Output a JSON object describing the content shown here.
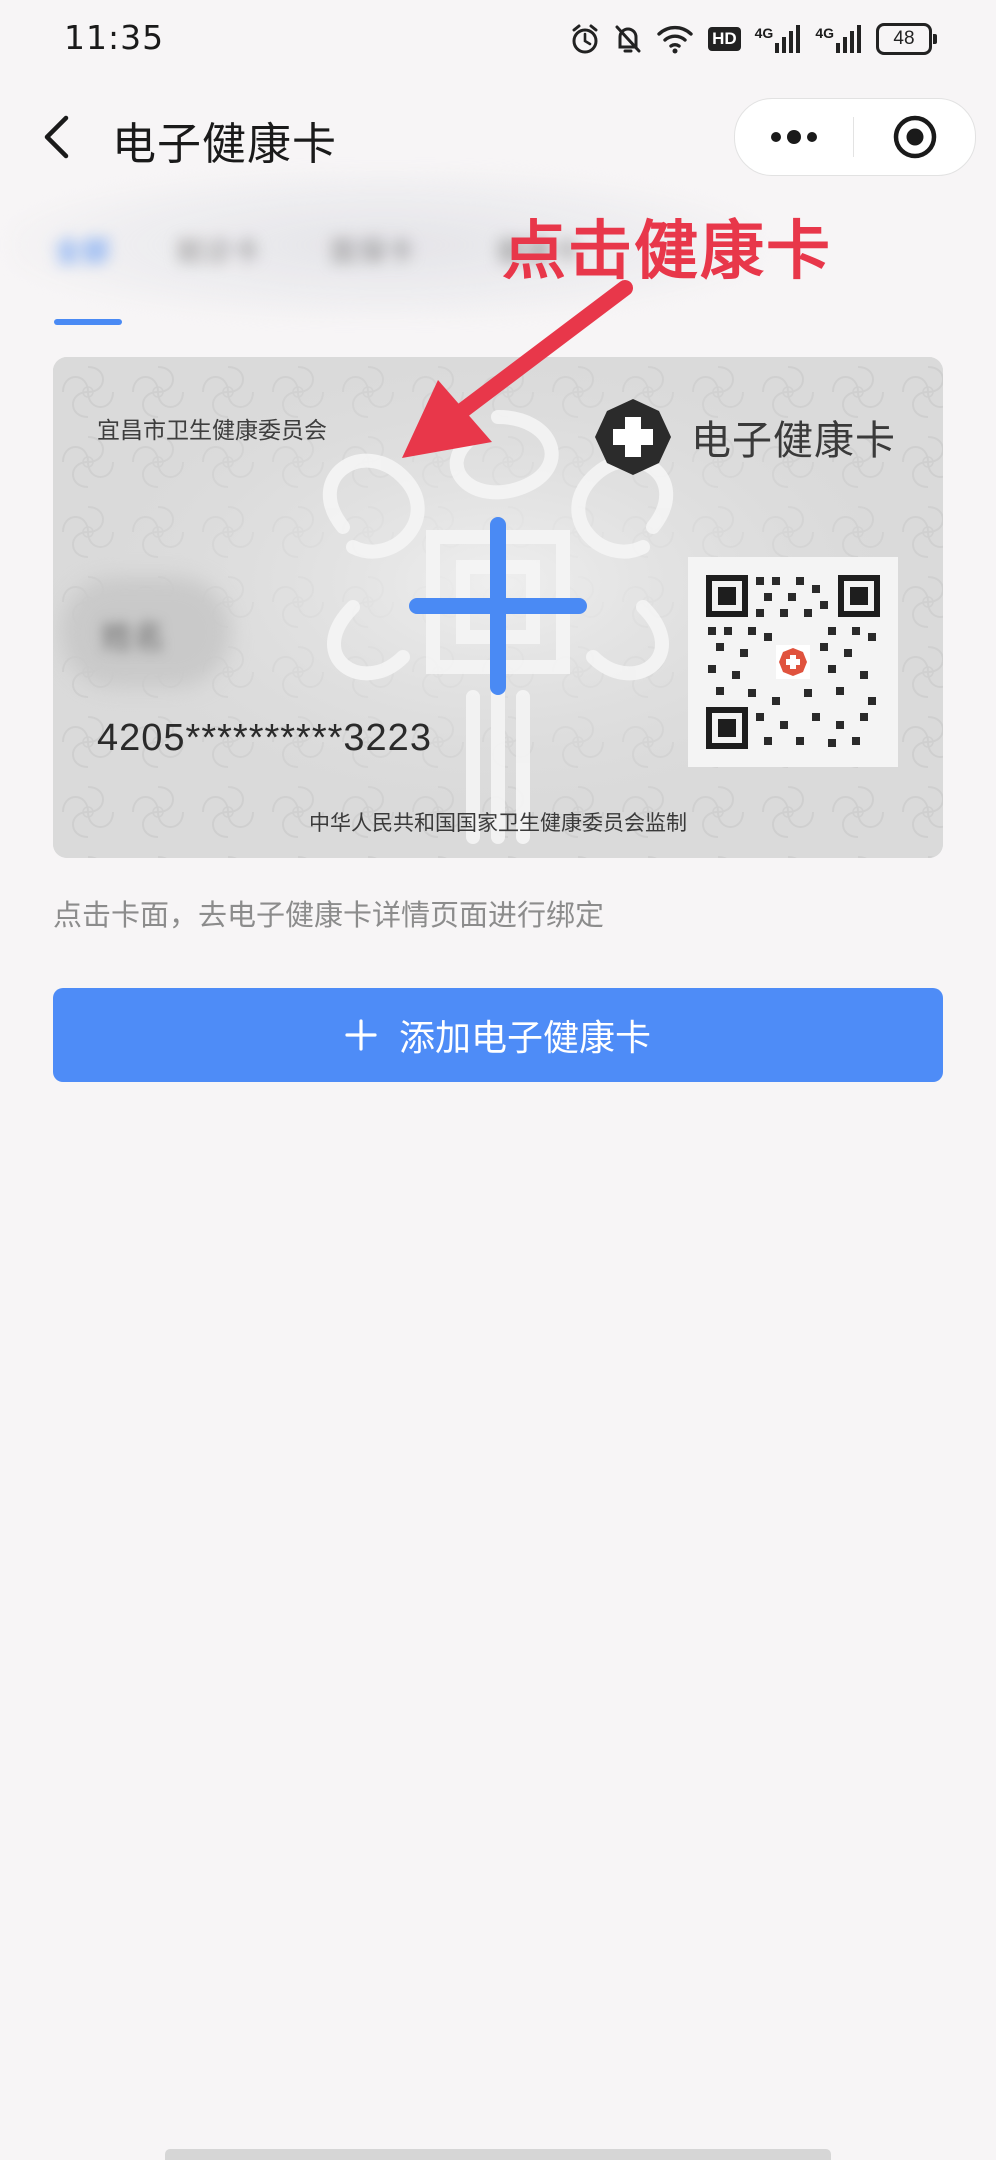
{
  "status_bar": {
    "time": "11:35",
    "network_1": "4G",
    "network_2": "4G",
    "hd_label": "HD",
    "battery": "48"
  },
  "nav": {
    "title": "电子健康卡"
  },
  "tabs": [
    {
      "label": "全部",
      "active": true
    },
    {
      "label": "就诊卡",
      "active": false
    },
    {
      "label": "医保卡",
      "active": false
    },
    {
      "label": "健康卡",
      "active": false
    }
  ],
  "annotation": {
    "text": "点击健康卡",
    "color": "#e8374a"
  },
  "card": {
    "issuer": "宜昌市卫生健康委员会",
    "brand": "电子健康卡",
    "name_blurred": "姓名",
    "id_number": "4205**********3223",
    "supervision": "中华人民共和国国家卫生健康委员会监制"
  },
  "hint": "点击卡面，去电子健康卡详情页面进行绑定",
  "add_button": {
    "label": "添加电子健康卡",
    "color": "#4e8cf7"
  }
}
